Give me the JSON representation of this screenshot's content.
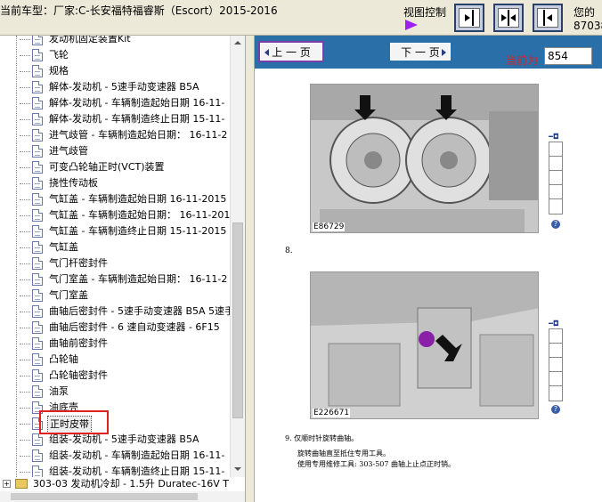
{
  "header": {
    "title": "当前车型：厂家:C-长安福特福睿斯（Escort）2015-2016",
    "view_control_label": "视图控制",
    "right_hint_line1": "您的",
    "right_hint_line2": "87038"
  },
  "tree": {
    "items": [
      {
        "label": "发动机固定装置Kit"
      },
      {
        "label": "飞轮"
      },
      {
        "label": "规格"
      },
      {
        "label": "解体-发动机 - 5速手动变速器 B5A"
      },
      {
        "label": "解体-发动机 - 车辆制造起始日期 16-11-"
      },
      {
        "label": "解体-发动机 - 车辆制造终止日期 15-11-"
      },
      {
        "label": "进气歧管 - 车辆制造起始日期： 16-11-2"
      },
      {
        "label": "进气歧管"
      },
      {
        "label": "可变凸轮轴正时(VCT)装置"
      },
      {
        "label": "挠性传动板"
      },
      {
        "label": "气缸盖 - 车辆制造起始日期 16-11-2015"
      },
      {
        "label": "气缸盖 - 车辆制造起始日期： 16-11-201"
      },
      {
        "label": "气缸盖 - 车辆制造终止日期 15-11-2015"
      },
      {
        "label": "气缸盖"
      },
      {
        "label": "气门杆密封件"
      },
      {
        "label": "气门室盖 - 车辆制造起始日期： 16-11-2"
      },
      {
        "label": "气门室盖"
      },
      {
        "label": "曲轴后密封件 - 5速手动变速器 B5A 5速手"
      },
      {
        "label": "曲轴后密封件 - 6 速自动变速器 - 6F15"
      },
      {
        "label": "曲轴前密封件"
      },
      {
        "label": "凸轮轴"
      },
      {
        "label": "凸轮轴密封件"
      },
      {
        "label": "油泵"
      },
      {
        "label": "油底壳"
      },
      {
        "label": "正时皮带"
      },
      {
        "label": "组装-发动机 - 5速手动变速器 B5A"
      },
      {
        "label": "组装-发动机 - 车辆制造起始日期 16-11-"
      },
      {
        "label": "组装-发动机 - 车辆制造终止日期 15-11-"
      }
    ],
    "selected_label": "正时皮带",
    "bottom_folder_label": "303-03 发动机冷却 - 1.5升 Duratec-16V T"
  },
  "nav": {
    "prev_label": "上 一 页",
    "next_label": "下 一 页",
    "current_label": "当前为",
    "current_page": "854"
  },
  "document": {
    "figure1_label": "E86729",
    "step8": "8.",
    "figure2_label": "E226671",
    "step9": "9.  仅顺时针旋转曲轴。",
    "step9_line1": "旋转曲轴直至抵住专用工具。",
    "step9_line2": "使用专用维修工具: 303-507  曲轴上止点正时销。"
  },
  "colors": {
    "accent_blue": "#2a6fa8",
    "highlight_red": "#e02020",
    "purple": "#a020f0"
  }
}
